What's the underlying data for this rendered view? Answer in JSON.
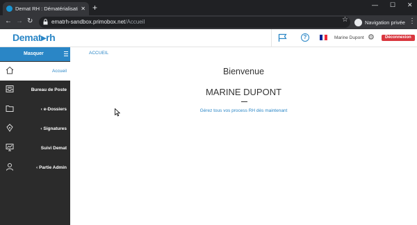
{
  "browser": {
    "tab_title": "Demat RH : Dématérialisation en l...",
    "tab_close": "✕",
    "new_tab": "+",
    "url_host": "ematrh-sandbox.primobox.net",
    "url_path": "/Accueil",
    "incognito_label": "Navigation privée",
    "controls": {
      "minimize": "—",
      "maximize": "☐",
      "close": "✕"
    },
    "nav": {
      "back": "←",
      "forward": "→",
      "reload": "↻"
    },
    "star": "☆",
    "menu": "⋮"
  },
  "header": {
    "logo": "Demat▸rh",
    "user_name": "Marine Dupont",
    "logout_label": "Déconnexion",
    "help_glyph": "?",
    "gear_glyph": "⚙",
    "colors": {
      "brand": "#2a86c6",
      "logout": "#d9363e"
    }
  },
  "sidebar": {
    "toggle_label": "Masquer",
    "items": [
      {
        "label": "Accueil",
        "icon": "home-icon",
        "active": true,
        "chevron": ""
      },
      {
        "label": "Bureau de Poste",
        "icon": "inbox-tray-icon",
        "active": false,
        "chevron": ""
      },
      {
        "label": "e-Dossiers",
        "icon": "folder-icon",
        "active": false,
        "chevron": "‹"
      },
      {
        "label": "Signatures",
        "icon": "pen-nib-icon",
        "active": false,
        "chevron": "‹"
      },
      {
        "label": "Suivi Demat",
        "icon": "monitor-chart-icon",
        "active": false,
        "chevron": ""
      },
      {
        "label": "Partie Admin",
        "icon": "user-icon",
        "active": false,
        "chevron": "‹"
      }
    ]
  },
  "main": {
    "breadcrumb": "ACCUEIL",
    "welcome": "Bienvenue",
    "user_fullname": "MARINE DUPONT",
    "tagline": "Gérez tous vos process RH dès maintenant"
  }
}
